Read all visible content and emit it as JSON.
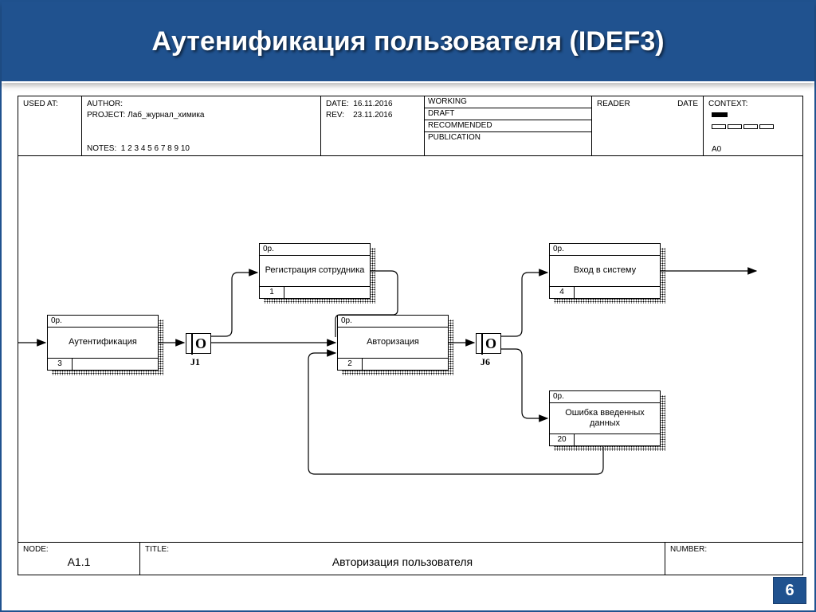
{
  "slide": {
    "title": "Аутенификация пользователя (IDEF3)",
    "page_number": "6"
  },
  "header": {
    "used_at": "USED AT:",
    "author_label": "AUTHOR:",
    "project_label": "PROJECT:",
    "project_value": "Лаб_журнал_химика",
    "notes_label": "NOTES:",
    "notes_value": "1 2 3 4 5 6 7 8 9 10",
    "date_label": "DATE:",
    "date_value": "16.11.2016",
    "rev_label": "REV:",
    "rev_value": "23.11.2016",
    "status": {
      "working": "WORKING",
      "draft": "DRAFT",
      "recommended": "RECOMMENDED",
      "publication": "PUBLICATION"
    },
    "reader_label": "READER",
    "reader_date_label": "DATE",
    "context_label": "CONTEXT:",
    "context_code": "A0"
  },
  "footer": {
    "node_label": "NODE:",
    "node_value": "A1.1",
    "title_label": "TITLE:",
    "title_value": "Авторизация пользователя",
    "number_label": "NUMBER:"
  },
  "boxes": {
    "b1": {
      "top": "0р.",
      "text": "Аутентификация",
      "num": "3"
    },
    "b2": {
      "top": "0р.",
      "text": "Регистрация сотрудника",
      "num": "1"
    },
    "b3": {
      "top": "0р.",
      "text": "Авторизация",
      "num": "2"
    },
    "b4": {
      "top": "0р.",
      "text": "Вход в систему",
      "num": "4"
    },
    "b5": {
      "top": "0р.",
      "text": "Ошибка введенных данных",
      "num": "20"
    }
  },
  "junctions": {
    "j1": {
      "symbol": "O",
      "label": "J1"
    },
    "j6": {
      "symbol": "O",
      "label": "J6"
    }
  }
}
